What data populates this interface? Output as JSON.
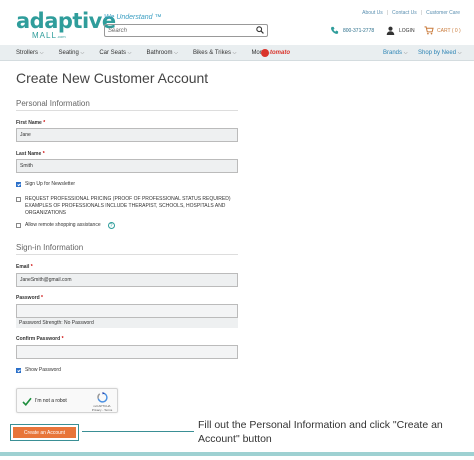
{
  "top_links": [
    "About Us",
    "Contact Us",
    "Customer Care"
  ],
  "logo": {
    "line1": "adaptive",
    "line2": "MALL",
    "suffix": ".com"
  },
  "tagline": "We Understand ™",
  "search": {
    "placeholder": "Search",
    "value": ""
  },
  "header": {
    "phone": "800-371-2778",
    "login": "LOGIN",
    "cart": "CART ( 0 )"
  },
  "nav": {
    "items": [
      "Strollers",
      "Seating",
      "Car Seats",
      "Bathroom",
      "Bikes & Trikes",
      "More"
    ],
    "brand_badge": "tomato",
    "brands": "Brands",
    "shop_by_need": "Shop by Need"
  },
  "form": {
    "title": "Create New Customer Account",
    "personal_section": "Personal Information",
    "first_name_label": "First Name",
    "first_name_value": "Jane",
    "last_name_label": "Last Name",
    "last_name_value": "Smith",
    "newsletter_label": "Sign Up for Newsletter",
    "professional_label": "REQUEST PROFESSIONAL PRICING (PROOF OF PROFESSIONAL STATUS REQUIRED) EXAMPLES OF PROFESSIONALS INCLUDE THERAPIST, SCHOOLS, HOSPITALS AND ORGANIZATIONS",
    "remote_label": "Allow remote shopping assistance",
    "signin_section": "Sign-in Information",
    "email_label": "Email",
    "email_value": "JaneSmith@gmail.com",
    "password_label": "Password",
    "password_value": "",
    "strength_text": "Password Strength: No Password",
    "confirm_label": "Confirm Password",
    "confirm_value": "",
    "show_password_label": "Show Password",
    "newsletter_checked": true,
    "professional_checked": false,
    "remote_checked": false,
    "show_password_checked": true
  },
  "captcha": {
    "label": "I'm not a robot",
    "brand": "reCAPTCHA",
    "links": "Privacy - Terms"
  },
  "submit_label": "Create an Account",
  "annotation": "Fill out the Personal Information and click \"Create an Account\" button",
  "colors": {
    "teal": "#2f9d9b",
    "orange": "#e8753a",
    "link": "#2c84b4"
  }
}
